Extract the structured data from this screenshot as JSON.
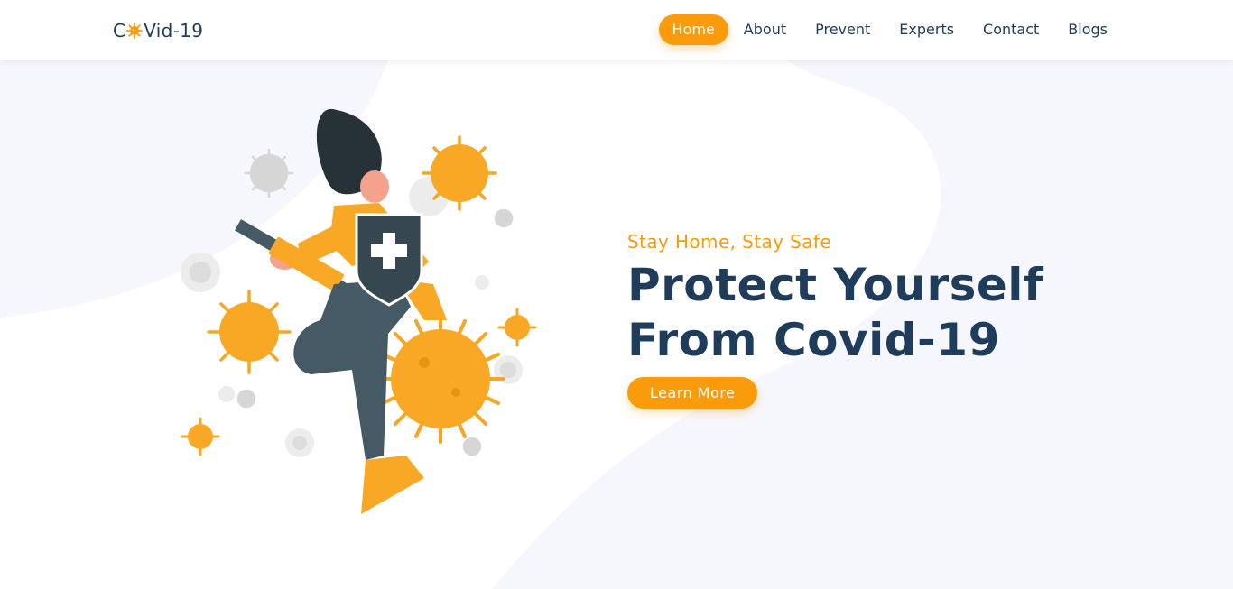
{
  "brand": {
    "logo_prefix": "C",
    "logo_suffix": "Vid-19",
    "logo_icon": "virus-icon"
  },
  "nav": {
    "items": [
      {
        "label": "Home",
        "active": true
      },
      {
        "label": "About",
        "active": false
      },
      {
        "label": "Prevent",
        "active": false
      },
      {
        "label": "Experts",
        "active": false
      },
      {
        "label": "Contact",
        "active": false
      },
      {
        "label": "Blogs",
        "active": false
      }
    ]
  },
  "hero": {
    "tagline": "Stay Home, Stay Safe",
    "headline_line1": "Protect Yourself",
    "headline_line2": "From Covid-19",
    "cta_label": "Learn More",
    "illustration": "woman-with-shield-and-syringe-fighting-viruses"
  },
  "colors": {
    "accent": "#f99b0b",
    "heading": "#1f3c5a",
    "background_blob": "#f7f8fc"
  }
}
